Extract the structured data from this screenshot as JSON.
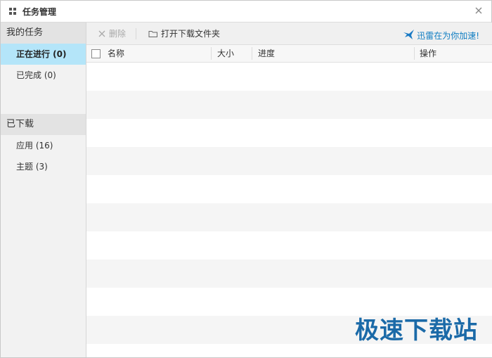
{
  "window": {
    "title": "任务管理"
  },
  "sidebar": {
    "groups": [
      {
        "title": "我的任务",
        "items": [
          {
            "label": "正在进行 (0)",
            "active": true
          },
          {
            "label": "已完成 (0)",
            "active": false
          }
        ]
      },
      {
        "title": "已下载",
        "items": [
          {
            "label": "应用 (16)",
            "active": false
          },
          {
            "label": "主题 (3)",
            "active": false
          }
        ]
      }
    ]
  },
  "toolbar": {
    "delete_label": "删除",
    "open_folder_label": "打开下载文件夹",
    "accelerate_label": "迅雷在为你加速!"
  },
  "table": {
    "columns": [
      "名称",
      "大小",
      "进度",
      "操作"
    ],
    "rows": []
  },
  "watermark": "极速下载站",
  "colors": {
    "active_item": "#b4e5f9",
    "accent_link": "#0f7dc2",
    "watermark": "#1b6aa8"
  }
}
